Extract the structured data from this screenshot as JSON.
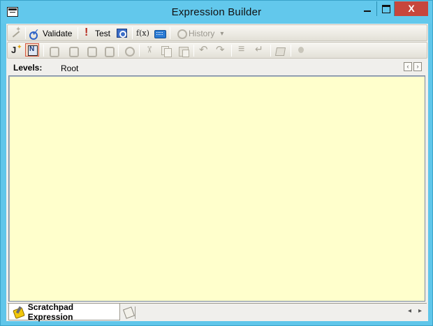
{
  "window": {
    "title": "Expression Builder",
    "title_bar_color": "#62c8ec",
    "close_button_color": "#c7463c",
    "close_glyph": "X"
  },
  "toolbar1": {
    "items": [
      {
        "icon": "wand-icon",
        "label": "",
        "enabled": false
      },
      {
        "icon": "validate-icon",
        "label": "Validate",
        "enabled": true
      },
      {
        "icon": "exclamation-icon",
        "label": "Test",
        "enabled": true
      },
      {
        "icon": "monitor-icon",
        "label": "",
        "enabled": true
      },
      {
        "icon": "function-icon",
        "label": "f(x)",
        "enabled": true
      },
      {
        "icon": "keyboard-icon",
        "label": "",
        "enabled": true
      },
      {
        "icon": "history-icon",
        "label": "History",
        "enabled": false
      }
    ],
    "history_dropdown_glyph": "▾"
  },
  "toolbar2": {
    "icons": [
      "insert-icon",
      "note-icon",
      "step-into-icon",
      "step-icon",
      "step-over-icon",
      "step-out-icon",
      "find-icon",
      "cut-icon",
      "copy-icon",
      "paste-icon",
      "undo-icon",
      "redo-icon",
      "align-icon",
      "wrap-icon",
      "box-icon",
      "bulb-icon"
    ]
  },
  "levels": {
    "label": "Levels:",
    "value": "Root",
    "prev_glyph": "‹",
    "next_glyph": "›"
  },
  "editor": {
    "background": "#ffffcc",
    "content": ""
  },
  "tabs": {
    "active": "Scratchpad Expression",
    "scroll_left": "◂",
    "scroll_right": "▸"
  }
}
